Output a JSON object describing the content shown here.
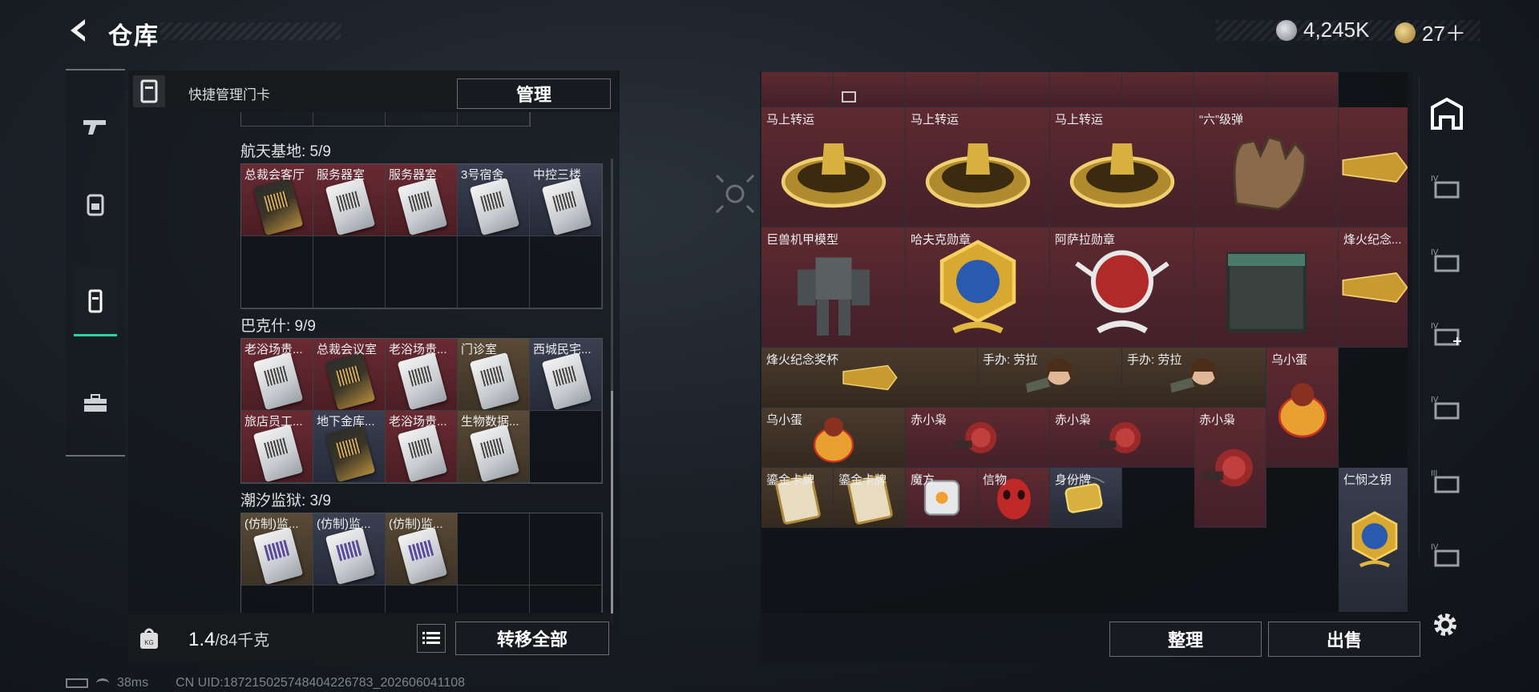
{
  "header": {
    "title": "仓库",
    "currency_1": "4,245K",
    "currency_2": "27＋"
  },
  "left_panel": {
    "header_text": "快捷管理门卡",
    "manage_button": "管理",
    "sections": [
      {
        "title": "航天基地: 5/9",
        "cells": [
          {
            "label": "总裁会客厅",
            "bg": "red",
            "card": "gold"
          },
          {
            "label": "服务器室",
            "bg": "red",
            "card": "white"
          },
          {
            "label": "服务器室",
            "bg": "red",
            "card": "white"
          },
          {
            "label": "3号宿舍",
            "bg": "blue",
            "card": "white"
          },
          {
            "label": "中控三楼",
            "bg": "blue",
            "card": "white"
          }
        ]
      },
      {
        "title": "巴克什: 9/9",
        "cells": [
          {
            "label": "老浴场贵...",
            "bg": "red",
            "card": "white"
          },
          {
            "label": "总裁会议室",
            "bg": "red",
            "card": "gold"
          },
          {
            "label": "老浴场贵...",
            "bg": "red",
            "card": "white"
          },
          {
            "label": "门诊室",
            "bg": "gold",
            "card": "white"
          },
          {
            "label": "西城民宅...",
            "bg": "blue",
            "card": "white"
          },
          {
            "label": "旅店员工...",
            "bg": "red",
            "card": "white"
          },
          {
            "label": "地下金库...",
            "bg": "blue",
            "card": "gold"
          },
          {
            "label": "老浴场贵...",
            "bg": "red",
            "card": "white"
          },
          {
            "label": "生物数据...",
            "bg": "gold",
            "card": "white"
          }
        ]
      },
      {
        "title": "潮汐监狱: 3/9",
        "cells": [
          {
            "label": "(仿制)监...",
            "bg": "gold",
            "card": "purple"
          },
          {
            "label": "(仿制)监...",
            "bg": "blue",
            "card": "purple"
          },
          {
            "label": "(仿制)监...",
            "bg": "gold",
            "card": "purple"
          }
        ]
      }
    ],
    "weight_current": "1.4",
    "weight_max": "/84千克",
    "transfer_all_button": "转移全部"
  },
  "right_panel": {
    "items": [
      {
        "label": "马上转运"
      },
      {
        "label": "马上转运"
      },
      {
        "label": "马上转运"
      },
      {
        "label": "“六”级弹"
      },
      {
        "label": "巨兽机甲模型"
      },
      {
        "label": "哈夫克勋章"
      },
      {
        "label": "阿萨拉勋章"
      },
      {
        "label": "烽火纪念..."
      },
      {
        "label": "烽火纪念奖杯"
      },
      {
        "label": "手办: 劳拉"
      },
      {
        "label": "手办: 劳拉"
      },
      {
        "label": "乌小蛋"
      },
      {
        "label": "乌小蛋"
      },
      {
        "label": "赤小枭"
      },
      {
        "label": "赤小枭"
      },
      {
        "label": "赤小枭"
      },
      {
        "label": "仁悯之钥"
      },
      {
        "label": "鎏金卡牌"
      },
      {
        "label": "鎏金卡牌"
      },
      {
        "label": "魔方"
      },
      {
        "label": "信物"
      },
      {
        "label": "身份牌"
      }
    ],
    "sort_button": "整理",
    "sell_button": "出售"
  },
  "status_bar": {
    "ping": "38ms",
    "uid": "CN UID:18721502574840422​6783_202606041108"
  },
  "colors": {
    "accent": "#2ed3a0",
    "cell_red": "#5e2a30",
    "cell_gold": "#4a3a2e",
    "cell_blue": "#3a3f50"
  }
}
